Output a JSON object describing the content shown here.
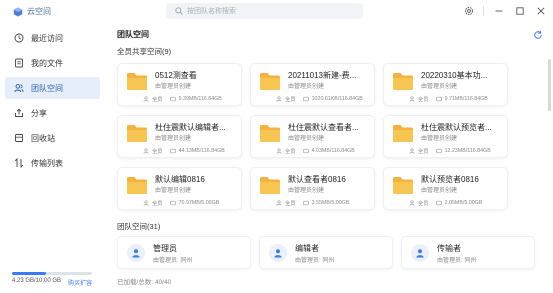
{
  "app": {
    "name": "云空间"
  },
  "search": {
    "placeholder": "按团队名称搜索"
  },
  "sidebar": {
    "items": [
      {
        "label": "最近访问",
        "icon": "clock-icon"
      },
      {
        "label": "我的文件",
        "icon": "file-icon"
      },
      {
        "label": "团队空间",
        "icon": "team-space-icon",
        "active": true
      },
      {
        "label": "分享",
        "icon": "share-icon"
      },
      {
        "label": "回收站",
        "icon": "trash-icon"
      },
      {
        "label": "传输列表",
        "icon": "transfer-icon"
      }
    ],
    "storage": {
      "text": "4.23 GB/10.00 GB",
      "link": "购买扩容",
      "used_fraction": 0.423
    }
  },
  "main": {
    "title": "团队空间",
    "shared_section": "全员共享空间(9)",
    "team_section": "团队空间(31)",
    "loaded_text": "已加载/总数: 40/40"
  },
  "spaces": [
    {
      "name": "0512测查看",
      "creator": "由管理员创建",
      "permission": "全员",
      "usage": "9.39MB/116.84GB"
    },
    {
      "name": "20211013新建-费...",
      "creator": "由管理员创建",
      "permission": "全员",
      "usage": "1020.61KB/116.84GB"
    },
    {
      "name": "20220310基本功...",
      "creator": "由管理员创建",
      "permission": "全员",
      "usage": "9.71MB/116.84GB"
    },
    {
      "name": "杜住震默认编辑者...",
      "creator": "由管理员创建",
      "permission": "全员",
      "usage": "44.13MB/116.84GB"
    },
    {
      "name": "杜住震默认查看者...",
      "creator": "由管理员创建",
      "permission": "全员",
      "usage": "4.03MB/116.84GB"
    },
    {
      "name": "杜住震默认预览者...",
      "creator": "由管理员创建",
      "permission": "全员",
      "usage": "12.23MB/116.84GB"
    },
    {
      "name": "默认编辑0816",
      "creator": "由管理员创建",
      "permission": "全员",
      "usage": "70.97MB/5.00GB"
    },
    {
      "name": "默认查看者0816",
      "creator": "由管理员创建",
      "permission": "全员",
      "usage": "3.55MB/5.00GB"
    },
    {
      "name": "默认预览者0816",
      "creator": "由管理员创建",
      "permission": "全员",
      "usage": "2.05MB/5.00GB"
    }
  ],
  "members": [
    {
      "role": "管理员",
      "creator": "由管理员: 同州"
    },
    {
      "role": "编辑者",
      "creator": "由管理员: 同州"
    },
    {
      "role": "传输者",
      "creator": "由管理员: 同州"
    }
  ],
  "colors": {
    "accent": "#3b7cf6",
    "folder": "#f7be4a",
    "active_bg": "#e6eefb"
  }
}
